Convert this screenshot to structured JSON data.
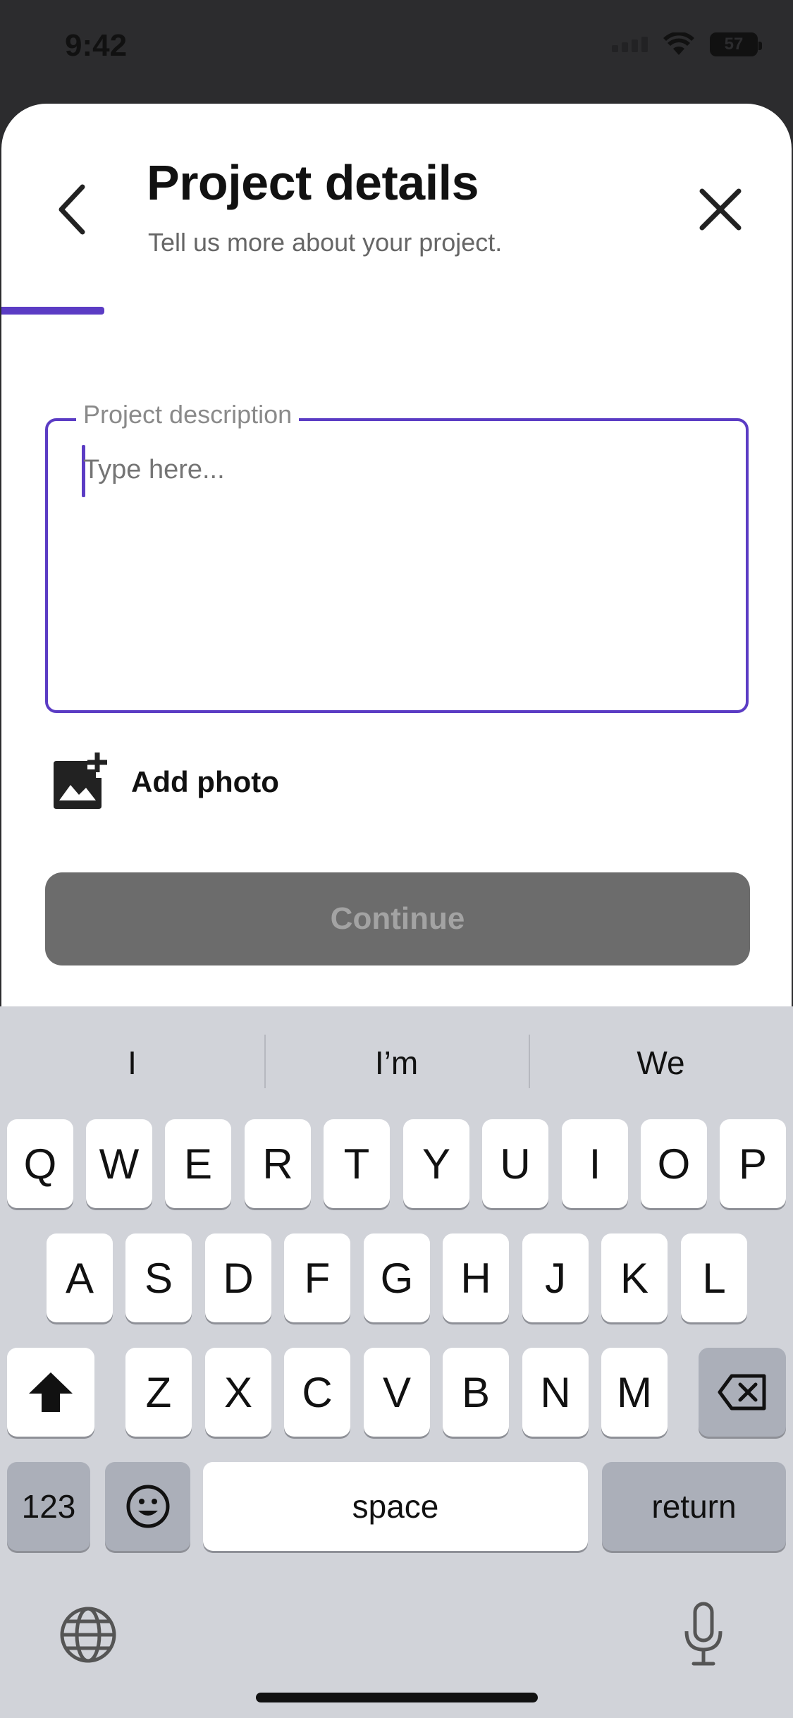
{
  "status_bar": {
    "time": "9:42",
    "battery": "57"
  },
  "header": {
    "title": "Project details",
    "subtitle": "Tell us more about your project.",
    "progress_fraction": 0.13
  },
  "form": {
    "description_label": "Project description",
    "description_placeholder": "Type here...",
    "add_photo_label": "Add photo",
    "continue_label": "Continue"
  },
  "keyboard": {
    "suggestions": [
      "I",
      "I’m",
      "We"
    ],
    "row1": [
      "Q",
      "W",
      "E",
      "R",
      "T",
      "Y",
      "U",
      "I",
      "O",
      "P"
    ],
    "row2": [
      "A",
      "S",
      "D",
      "F",
      "G",
      "H",
      "J",
      "K",
      "L"
    ],
    "row3": [
      "Z",
      "X",
      "C",
      "V",
      "B",
      "N",
      "M"
    ],
    "numbers_label": "123",
    "space_label": "space",
    "return_label": "return"
  },
  "colors": {
    "accent": "#5b3cc4",
    "button_disabled": "#6c6c6c",
    "keyboard_bg": "#d1d3d9"
  }
}
